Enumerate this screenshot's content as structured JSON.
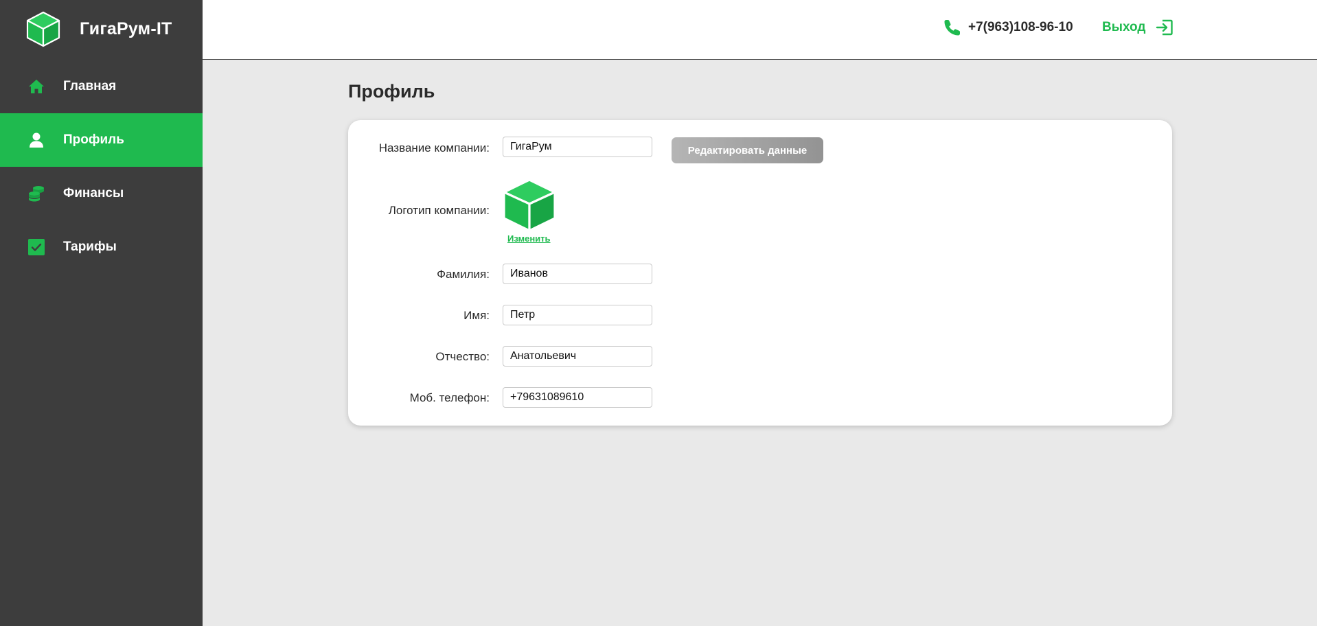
{
  "brand": {
    "name": "ГигаРум-IT",
    "logo_icon": "green-cube-icon"
  },
  "sidebar": {
    "items": [
      {
        "label": "Главная",
        "icon": "home-icon",
        "active": false
      },
      {
        "label": "Профиль",
        "icon": "user-icon",
        "active": true
      },
      {
        "label": "Финансы",
        "icon": "coins-icon",
        "active": false
      },
      {
        "label": "Тарифы",
        "icon": "checkbox-icon",
        "active": false
      }
    ]
  },
  "header": {
    "phone": "+7(963)108-96-10",
    "logout_label": "Выход"
  },
  "page": {
    "title": "Профиль"
  },
  "profile": {
    "company_name_label": "Название компании:",
    "company_name_value": "ГигаРум",
    "edit_button_label": "Редактировать данные",
    "logo_label": "Логотип компании:",
    "change_logo_link": "Изменить",
    "last_name_label": "Фамилия:",
    "last_name_value": "Иванов",
    "first_name_label": "Имя:",
    "first_name_value": "Петр",
    "middle_name_label": "Отчество:",
    "middle_name_value": "Анатольевич",
    "phone_label": "Моб. телефон:",
    "phone_value": "+79631089610"
  },
  "colors": {
    "accent": "#1fba4f",
    "sidebar_bg": "#3d3d3d",
    "page_bg": "#e9e9e9",
    "button_disabled": "#a9a9a9"
  }
}
